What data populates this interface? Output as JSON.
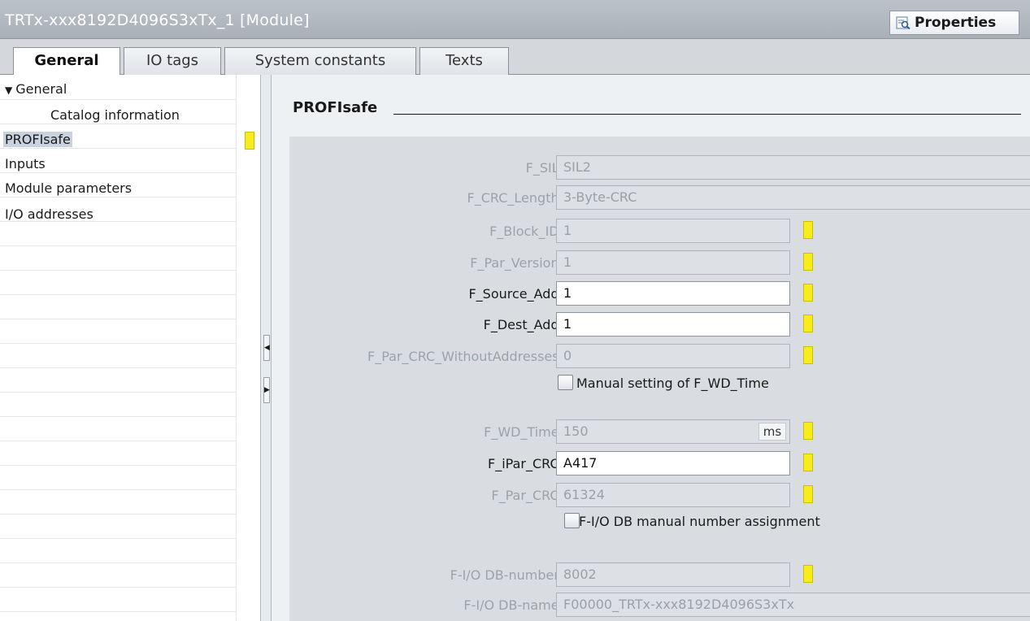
{
  "window": {
    "title": "TRTx-xxx8192D4096S3xTx_1 [Module]",
    "properties_button": "Properties"
  },
  "tabs": [
    {
      "label": "General",
      "active": true
    },
    {
      "label": "IO tags",
      "active": false
    },
    {
      "label": "System constants",
      "active": false
    },
    {
      "label": "Texts",
      "active": false
    }
  ],
  "sidebar": {
    "items": [
      {
        "label": "General",
        "expanded": true
      },
      {
        "label": "Catalog information"
      },
      {
        "label": "PROFIsafe",
        "selected": true
      },
      {
        "label": "Inputs"
      },
      {
        "label": "Module parameters"
      },
      {
        "label": "I/O addresses"
      }
    ]
  },
  "section": {
    "title": "PROFIsafe"
  },
  "fields": {
    "f_sil": {
      "label": "F_SIL:",
      "value": "SIL2"
    },
    "f_crc_length": {
      "label": "F_CRC_Length:",
      "value": "3-Byte-CRC"
    },
    "f_block_id": {
      "label": "F_Block_ID:",
      "value": "1"
    },
    "f_par_version": {
      "label": "F_Par_Version:",
      "value": "1"
    },
    "f_source_add": {
      "label": "F_Source_Add:",
      "value": "1"
    },
    "f_dest_add": {
      "label": "F_Dest_Add:",
      "value": "1"
    },
    "f_par_crc_without": {
      "label": "F_Par_CRC_WithoutAddresses:",
      "value": "0"
    },
    "manual_wd_time": {
      "label": "Manual setting of F_WD_Time",
      "checked": false
    },
    "f_wd_time": {
      "label": "F_WD_Time:",
      "value": "150",
      "unit": "ms"
    },
    "f_ipar_crc": {
      "label": "F_iPar_CRC:",
      "value": "A417"
    },
    "f_par_crc": {
      "label": "F_Par_CRC:",
      "value": "61324"
    },
    "fio_db_manual": {
      "label": "F-I/O DB manual number assignment",
      "checked": false
    },
    "fio_db_number": {
      "label": "F-I/O DB-number:",
      "value": "8002"
    },
    "fio_db_name": {
      "label": "F-I/O DB-name:",
      "value": "F00000_TRTx-xxx8192D4096S3xTx"
    }
  },
  "colors": {
    "marker": "#f6ec1e",
    "selection": "#c9d3df"
  }
}
